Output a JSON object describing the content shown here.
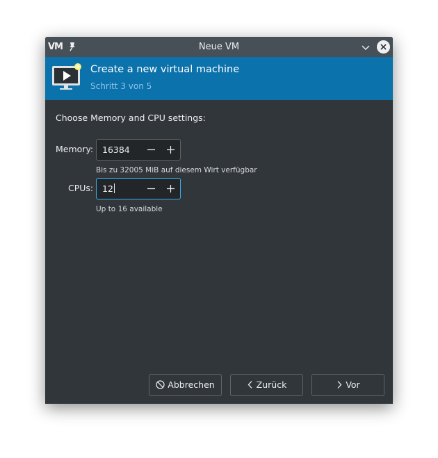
{
  "window": {
    "title": "Neue VM",
    "app_icon_text": "VM"
  },
  "banner": {
    "heading": "Create a new virtual machine",
    "subheading": "Schritt 3 von 5"
  },
  "form": {
    "section_label": "Choose Memory and CPU settings:",
    "memory": {
      "label": "Memory:",
      "value": "16384",
      "hint": "Bis zu 32005 MiB auf diesem Wirt verfügbar"
    },
    "cpus": {
      "label": "CPUs:",
      "value": "12",
      "hint": "Up to 16 available"
    }
  },
  "buttons": {
    "cancel": "Abbrechen",
    "back": "Zurück",
    "forward": "Vor"
  },
  "colors": {
    "banner": "#0c72ab",
    "titlebar": "#475057",
    "background": "#31363b",
    "focus": "#3daee9"
  }
}
